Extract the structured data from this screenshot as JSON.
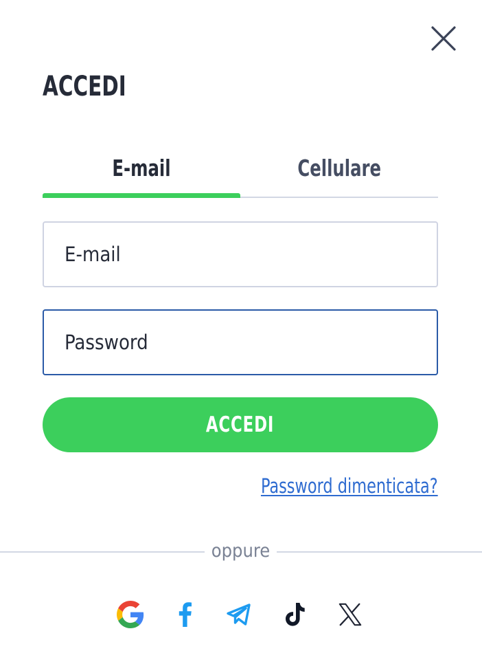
{
  "modal": {
    "title": "ACCEDI",
    "close_icon": "close-icon"
  },
  "tabs": [
    {
      "label": "E-mail",
      "active": true
    },
    {
      "label": "Cellulare",
      "active": false
    }
  ],
  "form": {
    "email_placeholder": "E-mail",
    "password_placeholder": "Password",
    "submit_label": "ACCEDI",
    "forgot_label": "Password dimenticata?"
  },
  "divider_label": "oppure",
  "social": [
    {
      "icon": "google-icon"
    },
    {
      "icon": "facebook-icon"
    },
    {
      "icon": "telegram-icon"
    },
    {
      "icon": "tiktok-icon"
    },
    {
      "icon": "x-icon"
    }
  ],
  "colors": {
    "accent": "#3ccf5c",
    "link": "#2e6bd0",
    "focus_border": "#2a5aa7",
    "text": "#262b38"
  }
}
